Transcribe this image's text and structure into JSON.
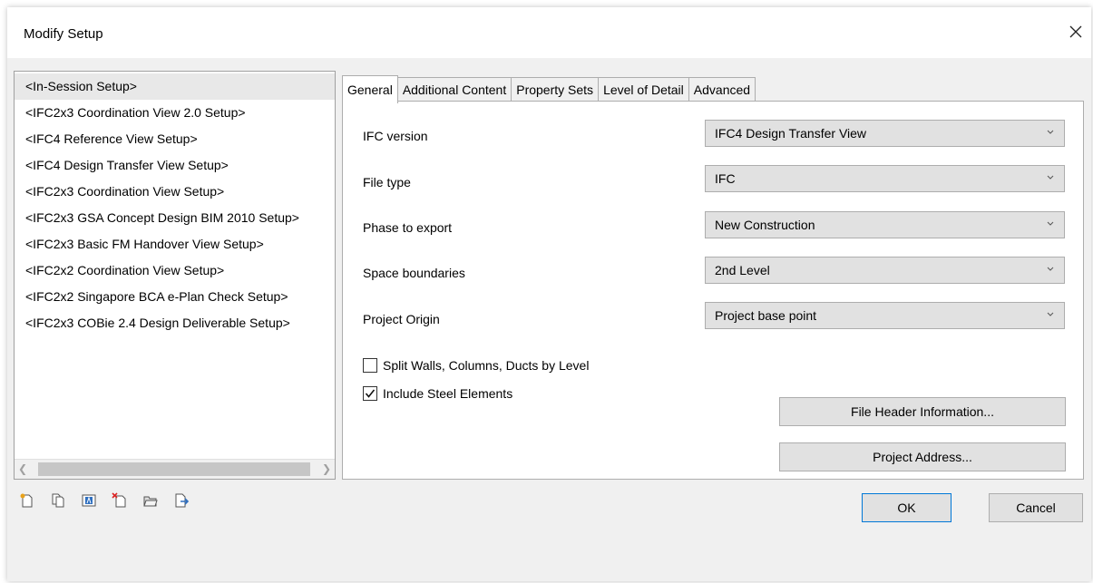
{
  "window": {
    "title": "Modify Setup"
  },
  "setups": [
    "<In-Session Setup>",
    "<IFC2x3 Coordination View 2.0 Setup>",
    "<IFC4 Reference View Setup>",
    "<IFC4 Design Transfer View Setup>",
    "<IFC2x3 Coordination View Setup>",
    "<IFC2x3 GSA Concept Design BIM 2010 Setup>",
    "<IFC2x3 Basic FM Handover View Setup>",
    "<IFC2x2 Coordination View Setup>",
    "<IFC2x2 Singapore BCA e-Plan Check Setup>",
    "<IFC2x3 COBie 2.4 Design Deliverable Setup>"
  ],
  "selected_setup_index": 0,
  "toolbar_icons": [
    "new-setup-icon",
    "duplicate-setup-icon",
    "rename-setup-icon",
    "delete-setup-icon",
    "import-setup-icon",
    "export-setup-icon"
  ],
  "tabs": [
    "General",
    "Additional Content",
    "Property Sets",
    "Level of Detail",
    "Advanced"
  ],
  "active_tab": "General",
  "fields": {
    "ifc_version": {
      "label": "IFC version",
      "value": "IFC4 Design Transfer View"
    },
    "file_type": {
      "label": "File type",
      "value": "IFC"
    },
    "phase": {
      "label": "Phase to export",
      "value": "New Construction"
    },
    "space_boundaries": {
      "label": "Space boundaries",
      "value": "2nd Level"
    },
    "project_origin": {
      "label": "Project Origin",
      "value": "Project base point"
    }
  },
  "checkboxes": {
    "split_walls": {
      "label": "Split Walls, Columns, Ducts by Level",
      "checked": false
    },
    "steel": {
      "label": "Include Steel Elements",
      "checked": true
    }
  },
  "buttons": {
    "file_header": "File Header Information...",
    "project_address": "Project Address...",
    "ok": "OK",
    "cancel": "Cancel"
  }
}
